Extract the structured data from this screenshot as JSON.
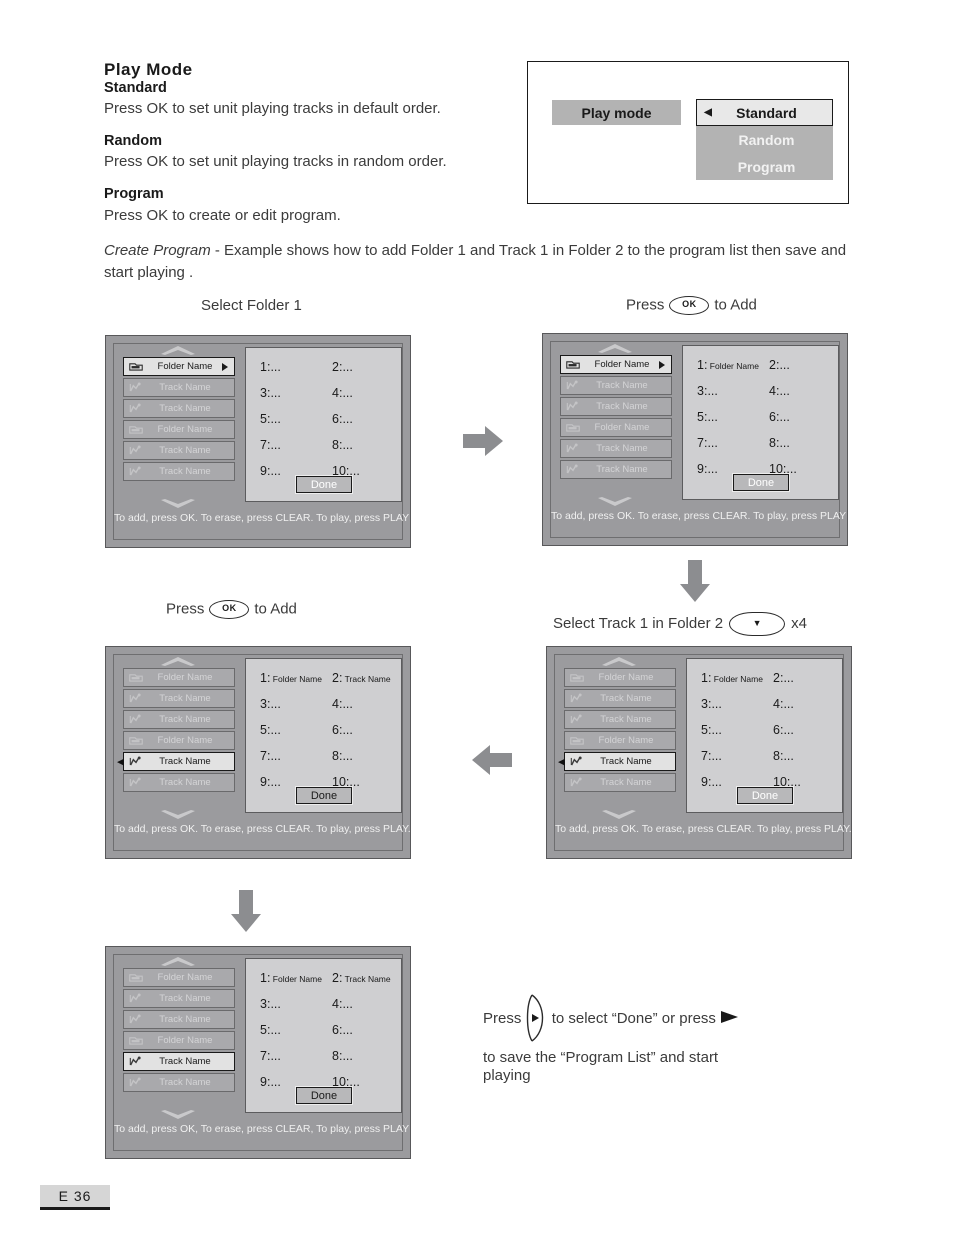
{
  "page": {
    "footer_label": "E 36"
  },
  "section": {
    "title": "Play  Mode",
    "standard_heading": "Standard",
    "standard_text": "Press OK to set unit playing tracks in default order.",
    "random_heading": "Random",
    "random_text": "Press OK to set unit playing tracks in random order.",
    "program_heading": "Program",
    "program_text": "Press OK to create or edit program.",
    "create_program_italic": "Create Program",
    "create_program_rest": " - Example shows how to add Folder 1 and Track 1 in Folder 2 to  the program list then save and start playing ."
  },
  "playmode_box": {
    "label": "Play mode",
    "options": [
      {
        "label": "Standard",
        "selected": true,
        "arrow": "◀"
      },
      {
        "label": "Random",
        "selected": false
      },
      {
        "label": "Program",
        "selected": false
      }
    ]
  },
  "common": {
    "status_bar": "To add, press OK. To erase, press CLEAR. To play, press PLAY",
    "status_bar_period": "To add, press OK. To erase, press CLEAR. To play, press PLAY.",
    "done_label": "Done",
    "folder_label": "Folder Name",
    "track_label": "Track Name",
    "ok_key": "OK",
    "down_key": "▼",
    "right_key": "▶"
  },
  "steps": [
    {
      "id": "step1",
      "caption": "Select Folder 1",
      "caption_suffix": "",
      "list": [
        {
          "label": "Folder Name",
          "icon": "folder-icon",
          "active": true,
          "arrow_right": true,
          "cursor_left": false
        },
        {
          "label": "Track Name",
          "icon": "track-icon",
          "active": false,
          "arrow_right": false,
          "cursor_left": false
        },
        {
          "label": "Track Name",
          "icon": "track-icon",
          "active": false,
          "arrow_right": false,
          "cursor_left": false
        },
        {
          "label": "Folder Name",
          "icon": "folder-icon",
          "active": false,
          "arrow_right": false,
          "cursor_left": false
        },
        {
          "label": "Track Name",
          "icon": "track-icon",
          "active": false,
          "arrow_right": false,
          "cursor_left": false
        },
        {
          "label": "Track Name",
          "icon": "track-icon",
          "active": false,
          "arrow_right": false,
          "cursor_left": false
        }
      ],
      "program_slots": [
        {
          "num": "1:",
          "value": "..."
        },
        {
          "num": "2:",
          "value": "..."
        },
        {
          "num": "3:",
          "value": "..."
        },
        {
          "num": "4:",
          "value": "..."
        },
        {
          "num": "5:",
          "value": "..."
        },
        {
          "num": "6:",
          "value": "..."
        },
        {
          "num": "7:",
          "value": "..."
        },
        {
          "num": "8:",
          "value": "..."
        },
        {
          "num": "9:",
          "value": "..."
        },
        {
          "num": "10:",
          "value": "..."
        }
      ],
      "status": "To add, press OK. To erase, press CLEAR. To play, press PLAY"
    },
    {
      "id": "step2",
      "caption": "Press",
      "caption_suffix": "to Add",
      "list": [
        {
          "label": "Folder Name",
          "icon": "folder-icon",
          "active": true,
          "arrow_right": true,
          "cursor_left": false
        },
        {
          "label": "Track Name",
          "icon": "track-icon",
          "active": false,
          "arrow_right": false,
          "cursor_left": false
        },
        {
          "label": "Track Name",
          "icon": "track-icon",
          "active": false,
          "arrow_right": false,
          "cursor_left": false
        },
        {
          "label": "Folder Name",
          "icon": "folder-icon",
          "active": false,
          "arrow_right": false,
          "cursor_left": false
        },
        {
          "label": "Track Name",
          "icon": "track-icon",
          "active": false,
          "arrow_right": false,
          "cursor_left": false
        },
        {
          "label": "Track Name",
          "icon": "track-icon",
          "active": false,
          "arrow_right": false,
          "cursor_left": false
        }
      ],
      "program_slots": [
        {
          "num": "1:",
          "value": "Folder Name"
        },
        {
          "num": "2:",
          "value": "..."
        },
        {
          "num": "3:",
          "value": "..."
        },
        {
          "num": "4:",
          "value": "..."
        },
        {
          "num": "5:",
          "value": "..."
        },
        {
          "num": "6:",
          "value": "..."
        },
        {
          "num": "7:",
          "value": "..."
        },
        {
          "num": "8:",
          "value": "..."
        },
        {
          "num": "9:",
          "value": "..."
        },
        {
          "num": "10:",
          "value": "..."
        }
      ],
      "status": "To add, press OK. To erase, press CLEAR. To play, press PLAY"
    },
    {
      "id": "step3",
      "caption": "Select Track 1 in Folder 2",
      "caption_suffix": "x4",
      "list": [
        {
          "label": "Folder Name",
          "icon": "folder-icon",
          "active": false,
          "arrow_right": false,
          "cursor_left": false
        },
        {
          "label": "Track Name",
          "icon": "track-icon",
          "active": false,
          "arrow_right": false,
          "cursor_left": false
        },
        {
          "label": "Track Name",
          "icon": "track-icon",
          "active": false,
          "arrow_right": false,
          "cursor_left": false
        },
        {
          "label": "Folder Name",
          "icon": "folder-icon",
          "active": false,
          "arrow_right": false,
          "cursor_left": false
        },
        {
          "label": "Track Name",
          "icon": "track-icon",
          "active": true,
          "arrow_right": false,
          "cursor_left": true
        },
        {
          "label": "Track Name",
          "icon": "track-icon",
          "active": false,
          "arrow_right": false,
          "cursor_left": false
        }
      ],
      "program_slots": [
        {
          "num": "1:",
          "value": "Folder Name"
        },
        {
          "num": "2:",
          "value": "..."
        },
        {
          "num": "3:",
          "value": "..."
        },
        {
          "num": "4:",
          "value": "..."
        },
        {
          "num": "5:",
          "value": "..."
        },
        {
          "num": "6:",
          "value": "..."
        },
        {
          "num": "7:",
          "value": "..."
        },
        {
          "num": "8:",
          "value": "..."
        },
        {
          "num": "9:",
          "value": "..."
        },
        {
          "num": "10:",
          "value": "..."
        }
      ],
      "status": "To add, press OK. To erase, press CLEAR. To play, press PLAY."
    },
    {
      "id": "step4",
      "caption": "Press",
      "caption_suffix": "to Add",
      "list": [
        {
          "label": "Folder Name",
          "icon": "folder-icon",
          "active": false,
          "arrow_right": false,
          "cursor_left": false
        },
        {
          "label": "Track Name",
          "icon": "track-icon",
          "active": false,
          "arrow_right": false,
          "cursor_left": false
        },
        {
          "label": "Track Name",
          "icon": "track-icon",
          "active": false,
          "arrow_right": false,
          "cursor_left": false
        },
        {
          "label": "Folder Name",
          "icon": "folder-icon",
          "active": false,
          "arrow_right": false,
          "cursor_left": false
        },
        {
          "label": "Track Name",
          "icon": "track-icon",
          "active": true,
          "arrow_right": false,
          "cursor_left": true
        },
        {
          "label": "Track Name",
          "icon": "track-icon",
          "active": false,
          "arrow_right": false,
          "cursor_left": false
        }
      ],
      "program_slots": [
        {
          "num": "1:",
          "value": "Folder Name"
        },
        {
          "num": "2:",
          "value": "Track Name"
        },
        {
          "num": "3:",
          "value": "..."
        },
        {
          "num": "4:",
          "value": "..."
        },
        {
          "num": "5:",
          "value": "..."
        },
        {
          "num": "6:",
          "value": "..."
        },
        {
          "num": "7:",
          "value": "..."
        },
        {
          "num": "8:",
          "value": "..."
        },
        {
          "num": "9:",
          "value": "..."
        },
        {
          "num": "10:",
          "value": "..."
        }
      ],
      "status": "To add, press OK. To erase, press CLEAR. To play, press PLAY."
    },
    {
      "id": "step5",
      "caption": "",
      "caption_suffix": "",
      "list": [
        {
          "label": "Folder Name",
          "icon": "folder-icon",
          "active": false,
          "arrow_right": false,
          "cursor_left": false
        },
        {
          "label": "Track Name",
          "icon": "track-icon",
          "active": false,
          "arrow_right": false,
          "cursor_left": false
        },
        {
          "label": "Track Name",
          "icon": "track-icon",
          "active": false,
          "arrow_right": false,
          "cursor_left": false
        },
        {
          "label": "Folder Name",
          "icon": "folder-icon",
          "active": false,
          "arrow_right": false,
          "cursor_left": false
        },
        {
          "label": "Track Name",
          "icon": "track-icon",
          "active": true,
          "arrow_right": false,
          "cursor_left": false
        },
        {
          "label": "Track Name",
          "icon": "track-icon",
          "active": false,
          "arrow_right": false,
          "cursor_left": false
        }
      ],
      "program_slots": [
        {
          "num": "1:",
          "value": "Folder Name"
        },
        {
          "num": "2:",
          "value": "Track Name"
        },
        {
          "num": "3:",
          "value": "..."
        },
        {
          "num": "4:",
          "value": "..."
        },
        {
          "num": "5:",
          "value": "..."
        },
        {
          "num": "6:",
          "value": "..."
        },
        {
          "num": "7:",
          "value": "..."
        },
        {
          "num": "8:",
          "value": "..."
        },
        {
          "num": "9:",
          "value": "..."
        },
        {
          "num": "10:",
          "value": "..."
        }
      ],
      "status": "To add, press OK, To erase, press CLEAR, To play, press PLAY"
    }
  ],
  "final_note": {
    "line1_pre": "Press",
    "line1_mid": "to select “Done” or press",
    "line2": "to save the “Program List” and start",
    "line3": "playing"
  }
}
